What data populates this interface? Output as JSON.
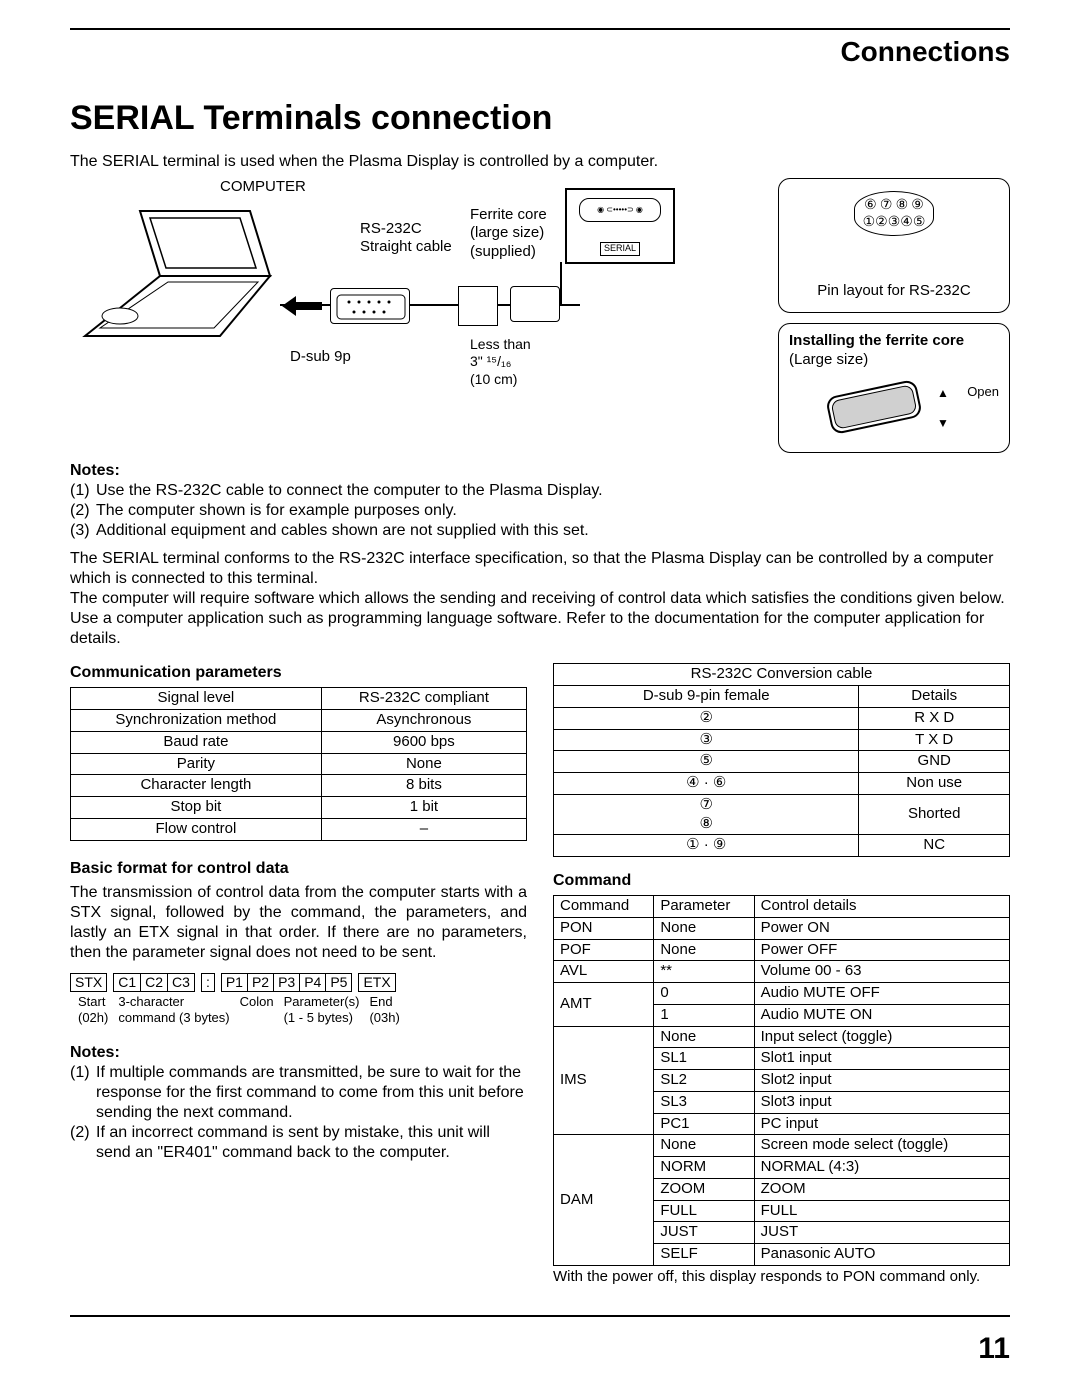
{
  "header": {
    "section": "Connections"
  },
  "title": "SERIAL Terminals connection",
  "intro": "The SERIAL terminal is used when the Plasma Display is controlled by a computer.",
  "diagram": {
    "computer": "COMPUTER",
    "cable": "RS-232C\nStraight cable",
    "dsub": "D-sub 9p",
    "ferrite": "Ferrite core\n(large size)\n(supplied)",
    "lessthan1": "Less than",
    "lessthan2": "3\" ¹⁵/₁₆",
    "lessthan3": "(10 cm)",
    "serial": "SERIAL"
  },
  "pinlayout": {
    "row1": [
      "⑥",
      "⑦",
      "⑧",
      "⑨"
    ],
    "row2": [
      "①",
      "②",
      "③",
      "④",
      "⑤"
    ],
    "caption": "Pin layout for RS-232C"
  },
  "ferrite_box": {
    "title": "Installing the ferrite core",
    "size": "(Large size)",
    "open": "Open"
  },
  "notes1": {
    "head": "Notes:",
    "items": [
      "Use the RS-232C cable to connect the computer to the Plasma Display.",
      "The computer shown is for example purposes only.",
      "Additional equipment and cables shown are not supplied with this set."
    ]
  },
  "para1": "The SERIAL terminal conforms to the RS-232C interface specification, so that the Plasma Display can be controlled by a computer which is connected to this terminal.",
  "para2": "The computer will require software which allows the sending and receiving of control data which satisfies the conditions given below. Use a computer application such as programming language software. Refer to the documentation for the computer application for details.",
  "comm": {
    "head": "Communication parameters",
    "rows": [
      [
        "Signal level",
        "RS-232C compliant"
      ],
      [
        "Synchronization method",
        "Asynchronous"
      ],
      [
        "Baud rate",
        "9600 bps"
      ],
      [
        "Parity",
        "None"
      ],
      [
        "Character length",
        "8 bits"
      ],
      [
        "Stop bit",
        "1 bit"
      ],
      [
        "Flow control",
        "–"
      ]
    ]
  },
  "conv": {
    "head": "RS-232C Conversion cable",
    "sub": [
      "D-sub 9-pin female",
      "Details"
    ],
    "rows": [
      [
        "②",
        "R X D"
      ],
      [
        "③",
        "T X D"
      ],
      [
        "⑤",
        "GND"
      ],
      [
        "④ · ⑥",
        "Non use"
      ],
      [
        "⑦\n⑧",
        "Shorted"
      ],
      [
        "① · ⑨",
        "NC"
      ]
    ]
  },
  "basic": {
    "head": "Basic format for control data",
    "text": "The transmission of control data from the computer starts with a STX signal, followed by the command, the parameters, and lastly an ETX signal in that order. If there are no parameters, then the parameter signal does not need to be sent.",
    "fmt": {
      "stx": "STX",
      "c1": "C1",
      "c2": "C2",
      "c3": "C3",
      "colon": ":",
      "p1": "P1",
      "p2": "P2",
      "p3": "P3",
      "p4": "P4",
      "p5": "P5",
      "etx": "ETX",
      "start": "Start\n(02h)",
      "cmd": "3-character\ncommand (3 bytes)",
      "coll": "Colon",
      "params": "Parameter(s)\n(1 - 5 bytes)",
      "end": "End\n(03h)"
    }
  },
  "notes2": {
    "head": "Notes:",
    "items": [
      "If multiple commands are transmitted, be sure to wait for the response for the first command to come from this unit before sending the next command.",
      "If an incorrect command is sent by mistake, this unit will send an \"ER401\" command back to the computer."
    ]
  },
  "command": {
    "head": "Command",
    "cols": [
      "Command",
      "Parameter",
      "Control details"
    ],
    "rows": [
      [
        "PON",
        "None",
        "Power ON"
      ],
      [
        "POF",
        "None",
        "Power OFF"
      ],
      [
        "AVL",
        "**",
        "Volume 00 - 63"
      ],
      [
        "AMT",
        "0",
        "Audio MUTE OFF"
      ],
      [
        "",
        "1",
        "Audio MUTE ON"
      ],
      [
        "IMS",
        "None",
        "Input select (toggle)"
      ],
      [
        "",
        "SL1",
        "Slot1 input"
      ],
      [
        "",
        "SL2",
        "Slot2 input"
      ],
      [
        "",
        "SL3",
        "Slot3 input"
      ],
      [
        "",
        "PC1",
        "PC input"
      ],
      [
        "DAM",
        "None",
        "Screen mode select (toggle)"
      ],
      [
        "",
        "NORM",
        "NORMAL (4:3)"
      ],
      [
        "",
        "ZOOM",
        "ZOOM"
      ],
      [
        "",
        "FULL",
        "FULL"
      ],
      [
        "",
        "JUST",
        "JUST"
      ],
      [
        "",
        "SELF",
        "Panasonic AUTO"
      ]
    ],
    "foot": "With the power off, this display responds to PON command only."
  },
  "page": "11"
}
